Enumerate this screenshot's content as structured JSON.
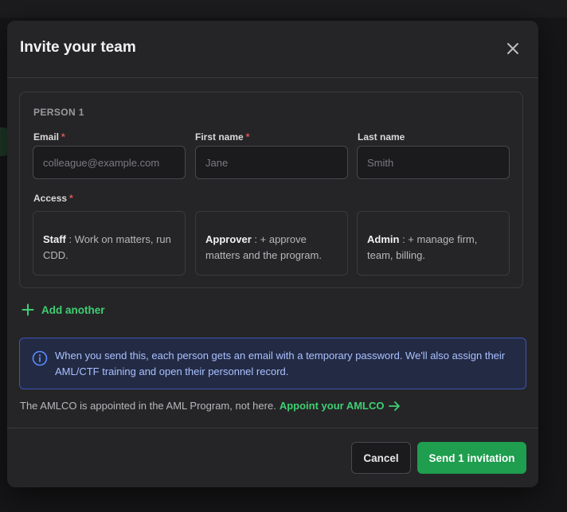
{
  "modal": {
    "title": "Invite your team",
    "close_icon": "close-icon"
  },
  "person": {
    "label": "PERSON 1",
    "email": {
      "label": "Email",
      "required": "*",
      "value": "",
      "placeholder": "colleague@example.com"
    },
    "first_name": {
      "label": "First name",
      "required": "*",
      "value": "",
      "placeholder": "Jane"
    },
    "last_name": {
      "label": "Last name",
      "value": "",
      "placeholder": "Smith"
    },
    "access": {
      "label": "Access",
      "required": "*",
      "roles": [
        {
          "name": "Staff",
          "description": " : Work on matters, run CDD."
        },
        {
          "name": "Approver",
          "description": " : + approve matters and the program."
        },
        {
          "name": "Admin",
          "description": " : + manage firm, team, billing."
        }
      ]
    }
  },
  "add_another": {
    "label": "Add another",
    "icon": "plus-icon"
  },
  "info": {
    "icon": "info-icon",
    "text": "When you send this, each person gets an email with a temporary password. We'll also assign their AML/CTF training and open their personnel record."
  },
  "amlco": {
    "text": "The AMLCO is appointed in the AML Program, not here.",
    "link_label": "Appoint your AMLCO",
    "link_icon": "arrow-right-icon"
  },
  "footer": {
    "cancel_label": "Cancel",
    "send_label": "Send 1 invitation"
  },
  "colors": {
    "accent": "#3ecf72",
    "primary_button": "#1e9e4e",
    "required": "#e05252",
    "info_border": "#3b55b8",
    "info_text": "#a9c1ff"
  }
}
